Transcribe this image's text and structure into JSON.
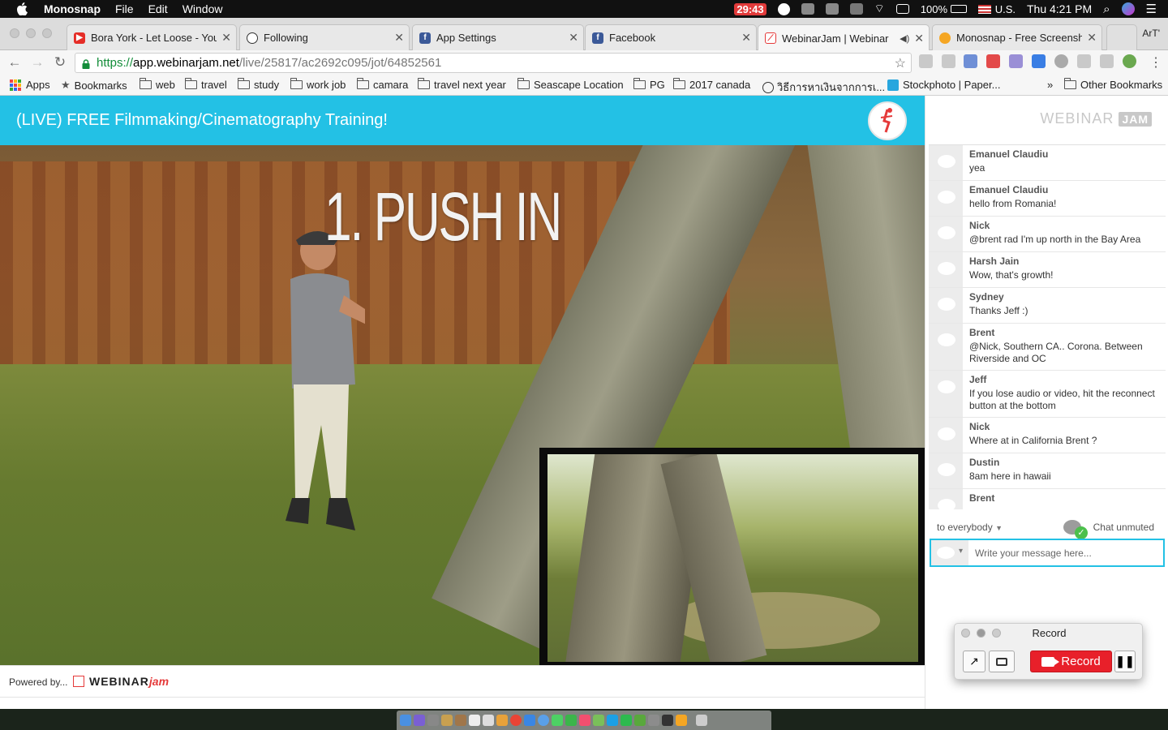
{
  "menubar": {
    "app": "Monosnap",
    "menus": [
      "File",
      "Edit",
      "Window"
    ],
    "timer": "29:43",
    "battery": "100%",
    "input_source": "U.S.",
    "clock": "Thu 4:21 PM"
  },
  "tabs": [
    {
      "title": "Bora York - Let Loose - You",
      "favicon": "youtube-icon",
      "color": "#e52d27"
    },
    {
      "title": "Following",
      "favicon": "following-icon",
      "color": "#333333"
    },
    {
      "title": "App Settings",
      "favicon": "facebook-icon",
      "color": "#3b5998"
    },
    {
      "title": "Facebook",
      "favicon": "facebook-icon",
      "color": "#3b5998"
    },
    {
      "title": "WebinarJam | Webinar",
      "favicon": "webinarjam-icon",
      "color": "#e53a3a"
    },
    {
      "title": "Monosnap - Free Screensho",
      "favicon": "monosnap-icon",
      "color": "#f5a623"
    }
  ],
  "profile_label": "ArT'",
  "address": {
    "protocol": "https://",
    "host": "app.webinarjam.net",
    "path": "/live/25817/ac2692c095/jot/64852561"
  },
  "bookmarks": {
    "apps": "Apps",
    "bookmarks": "Bookmarks",
    "items": [
      "web",
      "travel",
      "study",
      "work job",
      "camara",
      "travel next year",
      "Seascape Location",
      "PG",
      "2017 canada"
    ],
    "thai": "วิธีการหาเงินจากการเ...",
    "stockphoto": "Stockphoto | Paper...",
    "more": "»",
    "other": "Other Bookmarks"
  },
  "webinar": {
    "title": "(LIVE) FREE Filmmaking/Cinematography Training!",
    "video_overlay": "1. PUSH IN",
    "powered_by": "Powered by...",
    "brand_webinar": "WEBINAR",
    "brand_jam": "jam"
  },
  "chat": {
    "logo_text": "WEBINAR",
    "logo_badge": "JAM",
    "messages": [
      {
        "name": "Emanuel Claudiu",
        "text": "yea"
      },
      {
        "name": "Emanuel Claudiu",
        "text": "hello from Romania!"
      },
      {
        "name": "Nick",
        "text": "@brent rad I'm up north in the Bay Area"
      },
      {
        "name": "Harsh Jain",
        "text": "Wow, that's growth!"
      },
      {
        "name": "Sydney",
        "text": "Thanks Jeff :)"
      },
      {
        "name": "Brent",
        "text": "@Nick, Southern CA.. Corona. Between Riverside and OC"
      },
      {
        "name": "Jeff",
        "text": "If you lose audio or video, hit the reconnect button at the bottom"
      },
      {
        "name": "Nick",
        "text": "Where at in California Brent ?"
      },
      {
        "name": "Dustin",
        "text": "8am here in hawaii"
      },
      {
        "name": "Brent",
        "text": ""
      }
    ],
    "to_label": "to everybody",
    "status": "Chat unmuted",
    "placeholder": "Write your message here..."
  },
  "recorder": {
    "title": "Record",
    "record_label": "Record"
  }
}
